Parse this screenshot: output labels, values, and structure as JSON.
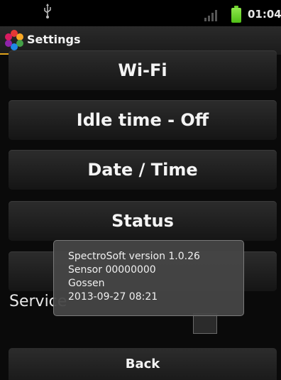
{
  "status_bar": {
    "time": "01:04",
    "icons": [
      "usb-icon",
      "signal-icon",
      "battery-icon"
    ],
    "battery_color": "#6fd42c"
  },
  "title_bar": {
    "title": "Settings",
    "icon": "app-colorwheel-icon",
    "accent_color": "#e0a31a"
  },
  "settings": [
    {
      "label": "Wi-Fi"
    },
    {
      "label": "Idle time - Off"
    },
    {
      "label": "Date / Time"
    },
    {
      "label": "Status"
    },
    {
      "label": ""
    }
  ],
  "service": {
    "label": "Service",
    "checked": false
  },
  "back_button": {
    "label": "Back"
  },
  "toast": {
    "lines": [
      "SpectroSoft version 1.0.26",
      "Sensor 00000000",
      "Gossen",
      "2013-09-27 08:21"
    ]
  }
}
